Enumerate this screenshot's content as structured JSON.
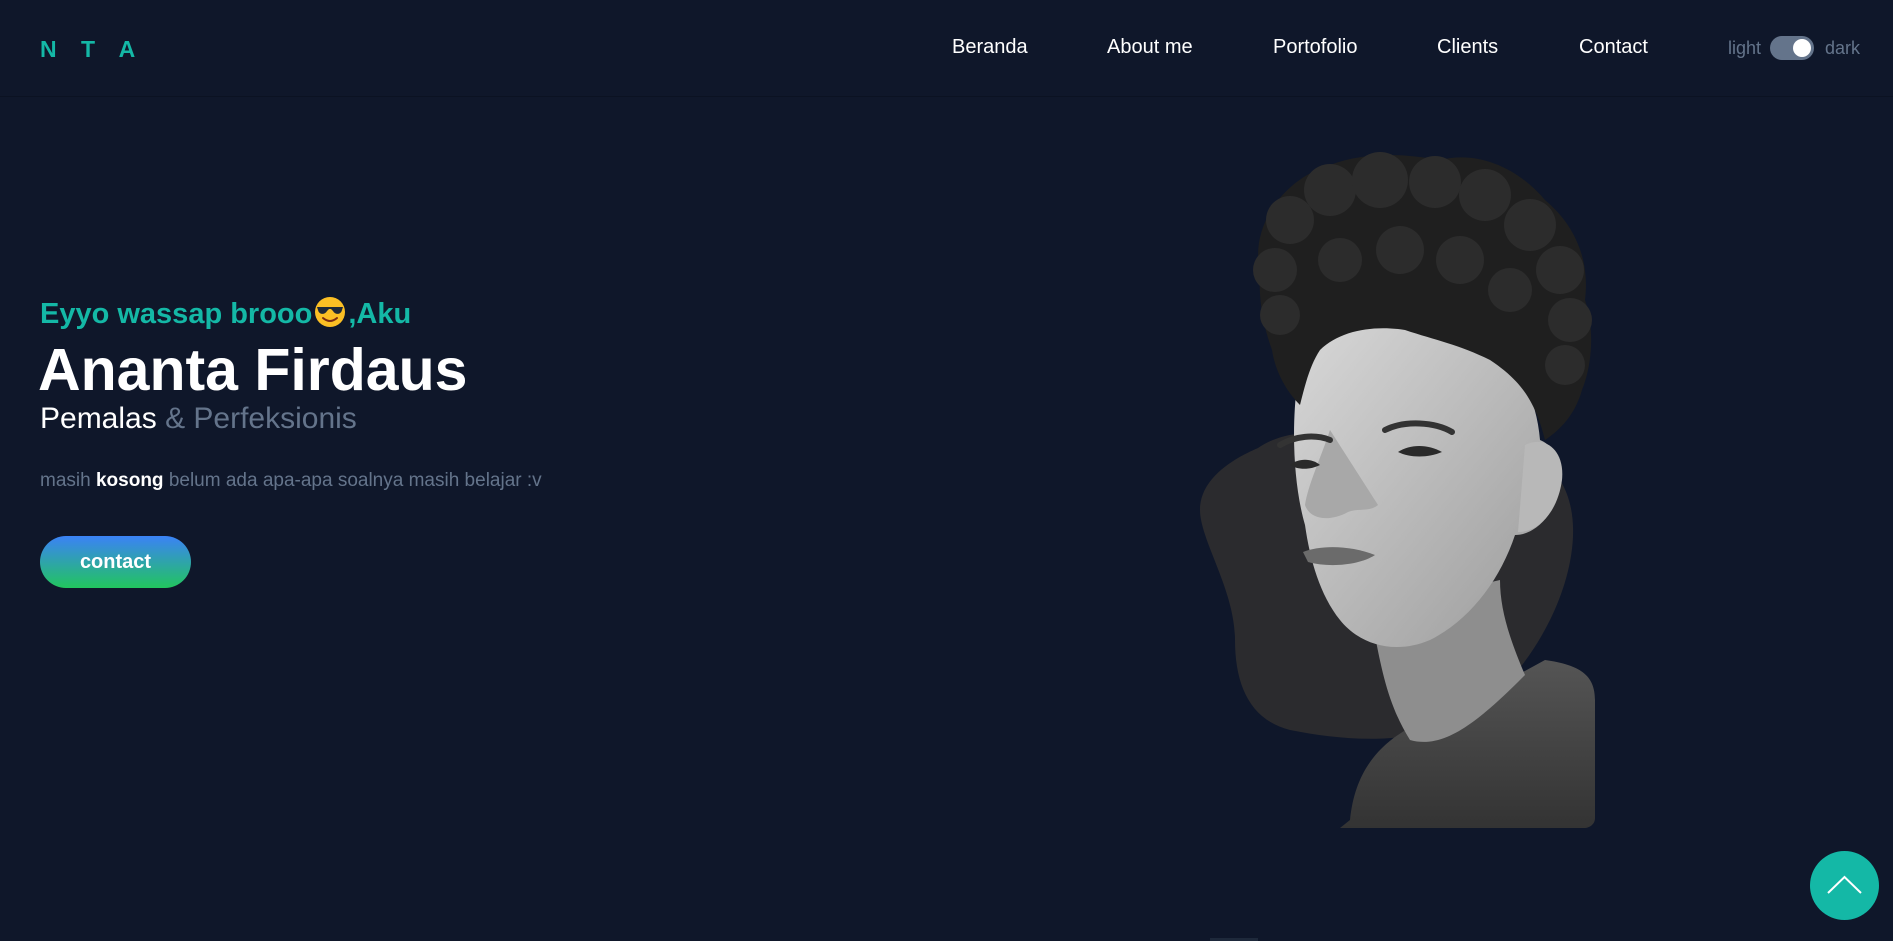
{
  "nav": {
    "brand": "N T A",
    "links": [
      "Beranda",
      "About me",
      "Portofolio",
      "Clients",
      "Contact"
    ],
    "toggle": {
      "light_label": "light",
      "dark_label": "dark",
      "state": "dark"
    }
  },
  "hero": {
    "greeting_before": "Eyyo wassap brooo",
    "greeting_emoji": "smiling-face-with-sunglasses",
    "greeting_after": ",Aku",
    "name": "Ananta Firdaus",
    "role_primary": "Pemalas",
    "role_secondary": "& Perfeksionis",
    "desc_before": "masih",
    "desc_bold": "kosong",
    "desc_after": "belum ada apa-apa soalnya masih belajar :v",
    "cta_label": "contact"
  },
  "back_to_top": {
    "icon": "chevron-up-icon"
  },
  "colors": {
    "background": "#0f172a",
    "accent": "#14b8a6",
    "muted": "#64748b",
    "text": "#ffffff",
    "button_gradient_start": "#3b82f6",
    "button_gradient_end": "#22c55e",
    "blob": "#2b2b2e"
  }
}
